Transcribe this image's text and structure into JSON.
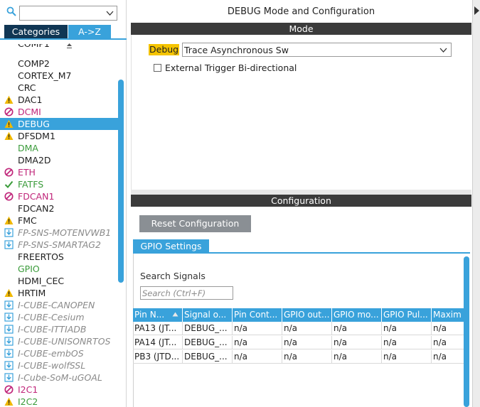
{
  "sidebar": {
    "search": {
      "value": "",
      "placeholder": ""
    },
    "tabs": {
      "categories": "Categories",
      "atoz": "A->Z"
    },
    "partial_item": "COMP1",
    "items": [
      {
        "label": "COMP2",
        "status": "none",
        "style": "normal"
      },
      {
        "label": "CORTEX_M7",
        "status": "none",
        "style": "normal"
      },
      {
        "label": "CRC",
        "status": "none",
        "style": "normal"
      },
      {
        "label": "DAC1",
        "status": "warning",
        "style": "normal"
      },
      {
        "label": "DCMI",
        "status": "error",
        "style": "error"
      },
      {
        "label": "DEBUG",
        "status": "warning",
        "style": "selected"
      },
      {
        "label": "DFSDM1",
        "status": "warning",
        "style": "normal"
      },
      {
        "label": "DMA",
        "status": "none",
        "style": "ok"
      },
      {
        "label": "DMA2D",
        "status": "none",
        "style": "normal"
      },
      {
        "label": "ETH",
        "status": "error",
        "style": "error"
      },
      {
        "label": "FATFS",
        "status": "ok",
        "style": "ok"
      },
      {
        "label": "FDCAN1",
        "status": "error",
        "style": "error"
      },
      {
        "label": "FDCAN2",
        "status": "none",
        "style": "normal"
      },
      {
        "label": "FMC",
        "status": "warning",
        "style": "normal"
      },
      {
        "label": "FP-SNS-MOTENVWB1",
        "status": "pack",
        "style": "pack"
      },
      {
        "label": "FP-SNS-SMARTAG2",
        "status": "pack",
        "style": "pack"
      },
      {
        "label": "FREERTOS",
        "status": "none",
        "style": "normal"
      },
      {
        "label": "GPIO",
        "status": "none",
        "style": "ok"
      },
      {
        "label": "HDMI_CEC",
        "status": "none",
        "style": "normal"
      },
      {
        "label": "HRTIM",
        "status": "warning",
        "style": "normal"
      },
      {
        "label": "I-CUBE-CANOPEN",
        "status": "pack",
        "style": "pack"
      },
      {
        "label": "I-CUBE-Cesium",
        "status": "pack",
        "style": "pack"
      },
      {
        "label": "I-CUBE-ITTIADB",
        "status": "pack",
        "style": "pack"
      },
      {
        "label": "I-CUBE-UNISONRTOS",
        "status": "pack",
        "style": "pack"
      },
      {
        "label": "I-CUBE-embOS",
        "status": "pack",
        "style": "pack"
      },
      {
        "label": "I-CUBE-wolfSSL",
        "status": "pack",
        "style": "pack"
      },
      {
        "label": "I-Cube-SoM-uGOAL",
        "status": "pack",
        "style": "pack"
      },
      {
        "label": "I2C1",
        "status": "error",
        "style": "error"
      },
      {
        "label": "I2C2",
        "status": "warning",
        "style": "ok"
      }
    ]
  },
  "main": {
    "title": "DEBUG Mode and Configuration",
    "mode_header": "Mode",
    "debug_label": "Debug",
    "debug_value": "Trace Asynchronous Sw",
    "ext_trigger_label": "External Trigger Bi-directional",
    "ext_trigger_checked": false,
    "config_header": "Configuration",
    "reset_label": "Reset Configuration",
    "gpio_tab": "GPIO Settings",
    "search_signals_label": "Search Signals",
    "search_signals_placeholder": "Search (Ctrl+F)",
    "table": {
      "columns": [
        "Pin N...",
        "Signal o...",
        "Pin Cont...",
        "GPIO out...",
        "GPIO mo...",
        "GPIO Pul...",
        "Maxim"
      ],
      "rows": [
        [
          "PA13 (JT...",
          "DEBUG_...",
          "n/a",
          "n/a",
          "n/a",
          "n/a",
          "n/a"
        ],
        [
          "PA14 (JT...",
          "DEBUG_...",
          "n/a",
          "n/a",
          "n/a",
          "n/a",
          "n/a"
        ],
        [
          "PB3 (JTD...",
          "DEBUG_...",
          "n/a",
          "n/a",
          "n/a",
          "n/a",
          "n/a"
        ]
      ]
    }
  },
  "colors": {
    "accent": "#39a2db",
    "dark_tab": "#103654",
    "header_bar": "#3b3b3b",
    "highlight": "#f5c400",
    "warning": "#f0b800",
    "error": "#c0267a",
    "ok": "#3a9b3a",
    "button_gray": "#8a8f94"
  }
}
